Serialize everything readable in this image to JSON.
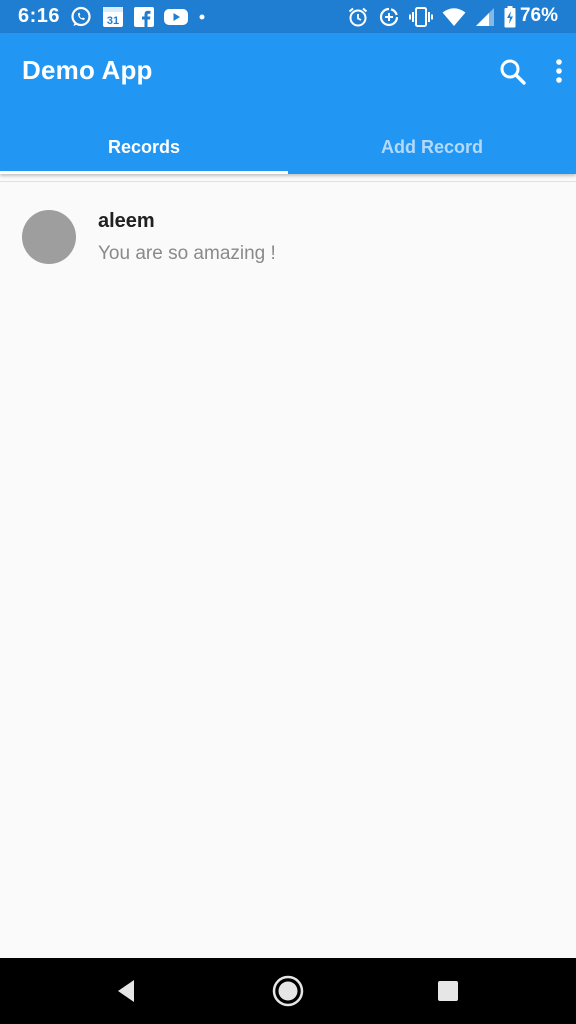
{
  "status_bar": {
    "time": "6:16",
    "battery_percent": "76%",
    "left_icons": [
      "whatsapp-icon",
      "calendar-icon",
      "facebook-icon",
      "youtube-icon",
      "dot-icon"
    ],
    "right_icons": [
      "alarm-icon",
      "data-saver-icon",
      "vibrate-icon",
      "wifi-icon",
      "signal-icon",
      "battery-charging-icon"
    ],
    "calendar_day": "31"
  },
  "app_bar": {
    "title": "Demo App",
    "actions": [
      "search-icon",
      "more-vert-icon"
    ]
  },
  "tabs": [
    {
      "label": "Records",
      "active": true
    },
    {
      "label": "Add Record",
      "active": false
    }
  ],
  "records": [
    {
      "name": "aleem",
      "message": "You are so amazing !"
    }
  ],
  "nav_bar": {
    "buttons": [
      "back-icon",
      "home-icon",
      "recents-icon"
    ]
  },
  "colors": {
    "status_bar": "#1f7ed2",
    "primary": "#2196f3",
    "inactive_tab_text": "#b3dafc",
    "avatar": "#9e9e9e",
    "background": "#fafafa"
  }
}
